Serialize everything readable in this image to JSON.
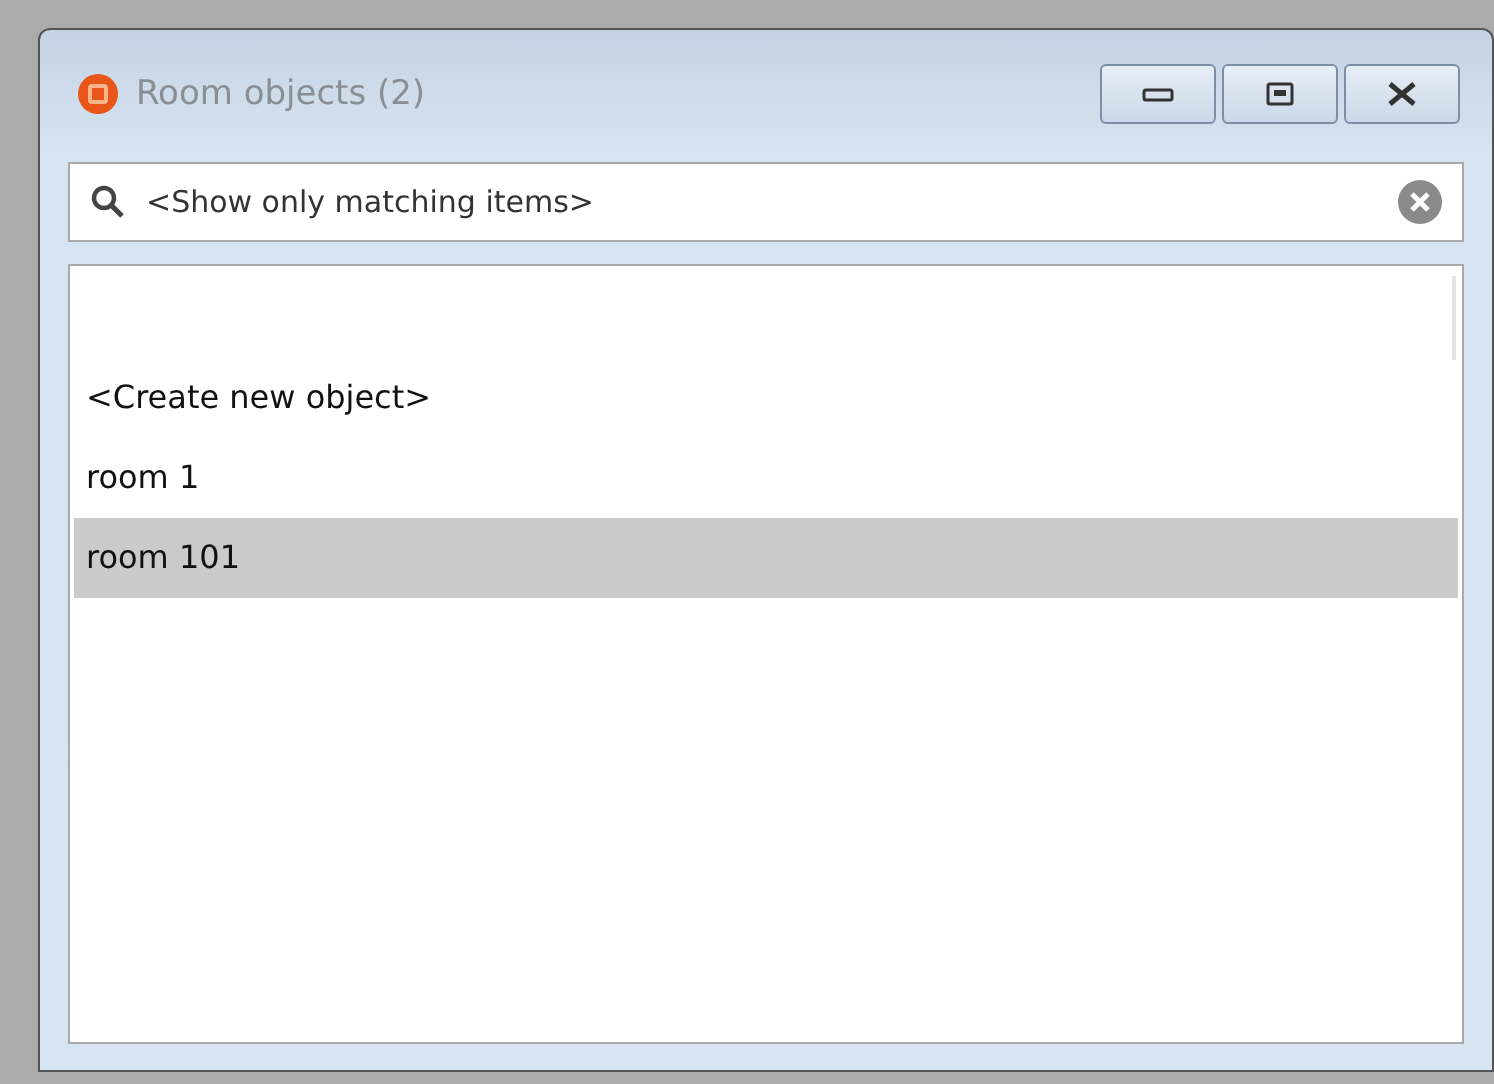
{
  "window": {
    "title": "Room objects (2)"
  },
  "search": {
    "placeholder": "<Show only matching items>"
  },
  "items": [
    {
      "label": "<Create new object>",
      "selected": false
    },
    {
      "label": "room 1",
      "selected": false
    },
    {
      "label": "room 101",
      "selected": true
    }
  ]
}
